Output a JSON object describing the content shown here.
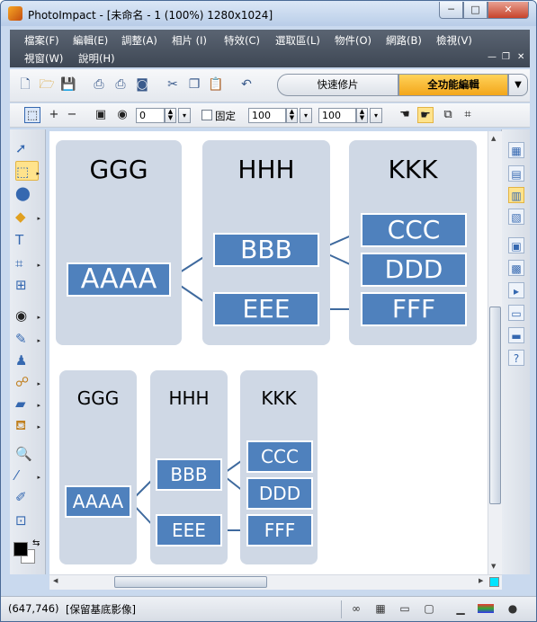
{
  "window": {
    "title": "PhotoImpact - [未命名 - 1 (100%) 1280x1024]",
    "controls": {
      "minimize": "─",
      "maximize": "□",
      "close": "✕"
    }
  },
  "menubar": {
    "items": [
      "檔案(F)",
      "編輯(E)",
      "調整(A)",
      "相片 (I)",
      "特效(C)",
      "選取區(L)",
      "物件(O)",
      "網路(B)",
      "檢視(V)"
    ],
    "items_row2": [
      "視窗(W)",
      "說明(H)"
    ],
    "mdi_controls": {
      "minimize": "—",
      "restore": "❐",
      "close": "✕"
    }
  },
  "toolbar": {
    "icons": [
      "new-icon",
      "open-icon",
      "save-icon",
      "scan-icon",
      "print-icon",
      "camera-icon",
      "cut-icon",
      "copy-icon",
      "paste-icon",
      "undo-icon"
    ],
    "quick_fix_label": "快速修片",
    "full_edit_label": "全功能編輯",
    "mode_dropdown": "▼"
  },
  "attributes": {
    "value1": "0",
    "fixed_label": "固定",
    "width": "100",
    "height": "100"
  },
  "status": {
    "coords": "(647,746)",
    "message": "[保留基底影像]"
  },
  "diagram_large": {
    "columns": [
      "GGG",
      "HHH",
      "KKK"
    ],
    "nodes": {
      "root": "AAAA",
      "b": "BBB",
      "e": "EEE",
      "c": "CCC",
      "d": "DDD",
      "f": "FFF"
    }
  },
  "diagram_small": {
    "columns": [
      "GGG",
      "HHH",
      "KKK"
    ],
    "nodes": {
      "root": "AAAA",
      "b": "BBB",
      "e": "EEE",
      "c": "CCC",
      "d": "DDD",
      "f": "FFF"
    }
  },
  "colors": {
    "panel": "#cfd8e5",
    "box": "#4f81bd",
    "connector": "#3f6a9e",
    "accent": "#f3a61a"
  }
}
